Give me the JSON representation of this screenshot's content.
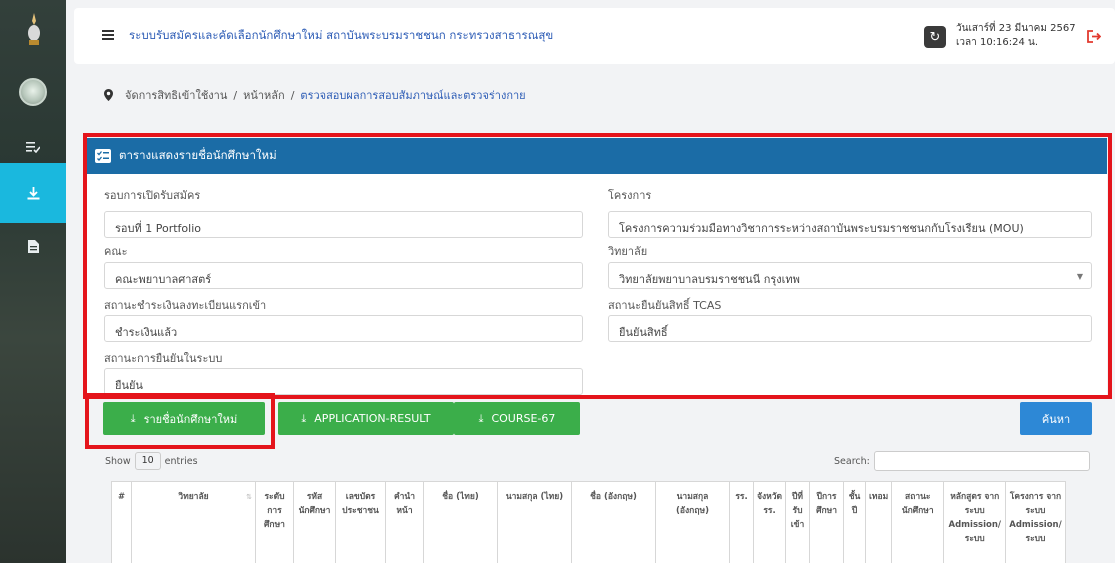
{
  "header": {
    "app_title": "ระบบรับสมัครและคัดเลือกนักศึกษาใหม่ สถาบันพระบรมราชชนก กระทรวงสาธารณสุข",
    "date": "วันเสาร์ที่ 23 มีนาคม 2567",
    "time": "เวลา 10:16:24 น."
  },
  "breadcrumb": {
    "items": [
      "จัดการสิทธิเข้าใช้งาน",
      "หน้าหลัก"
    ],
    "current": "ตรวจสอบผลการสอบสัมภาษณ์และตรวจร่างกาย",
    "separator": "/"
  },
  "card": {
    "title": "ตารางแสดงรายชื่อนักศึกษาใหม่",
    "fields": {
      "round": {
        "label": "รอบการเปิดรับสมัคร",
        "value": "รอบที่ 1 Portfolio"
      },
      "project": {
        "label": "โครงการ",
        "value": "โครงการความร่วมมือทางวิชาการระหว่างสถาบันพระบรมราชชนกกับโรงเรียน (MOU)"
      },
      "faculty": {
        "label": "คณะ",
        "value": "คณะพยาบาลศาสตร์"
      },
      "college": {
        "label": "วิทยาลัย",
        "value": "วิทยาลัยพยาบาลบรมราชชนนี กรุงเทพ"
      },
      "payment": {
        "label": "สถานะชำระเงินลงทะเบียนแรกเข้า",
        "value": "ชำระเงินแล้ว"
      },
      "tcas": {
        "label": "สถานะยืนยันสิทธิ์ TCAS",
        "value": "ยืนยันสิทธิ์"
      },
      "confirm": {
        "label": "สถานะการยืนยันในระบบ",
        "value": "ยืนยัน"
      }
    }
  },
  "buttons": {
    "new_students": "รายชื่อนักศึกษาใหม่",
    "application_result": "APPLICATION-RESULT",
    "course": "COURSE-67",
    "search": "ค้นหา"
  },
  "table": {
    "show_label": "Show",
    "show_value": "10",
    "entries_label": "entries",
    "search_label": "Search:",
    "columns": [
      "#",
      "วิทยาลัย",
      "ระดับการศึกษา",
      "รหัสนักศึกษา",
      "เลขบัตรประชาชน",
      "คำนำหน้า",
      "ชื่อ (ไทย)",
      "นามสกุล (ไทย)",
      "ชื่อ (อังกฤษ)",
      "นามสกุล (อังกฤษ)",
      "รร.",
      "จังหวัด รร.",
      "ปีที่รับเข้า",
      "ปีการศึกษา",
      "ชั้นปี",
      "เทอม",
      "สถานะนักศึกษา",
      "หลักสูตร จากระบบ Admission/ ระบบ",
      "โครงการ จากระบบ Admission/ ระบบ"
    ]
  },
  "colors": {
    "header_blue": "#1b6ca6",
    "button_green": "#3bae4a",
    "button_blue": "#2d88d6",
    "sidebar_active": "#1ab8de",
    "highlight_red": "#e4141b",
    "title_blue": "#2e5db6"
  }
}
